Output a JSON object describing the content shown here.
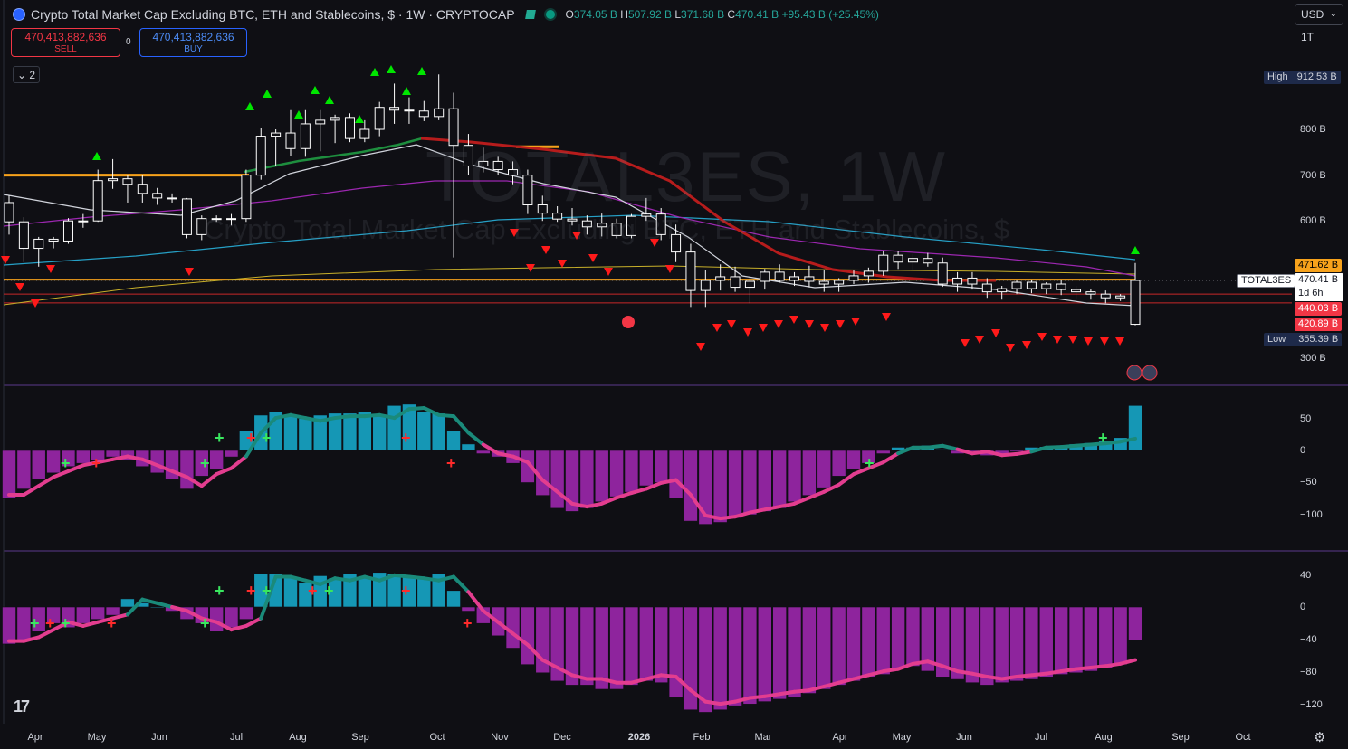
{
  "header": {
    "title": "Crypto Total Market Cap Excluding BTC, ETH and Stablecoins, $ · 1W · CRYPTOCAP",
    "ohlc": {
      "o_label": "O",
      "o": "374.05 B",
      "h_label": "H",
      "h": "507.92 B",
      "l_label": "L",
      "l": "371.68 B",
      "c_label": "C",
      "c": "470.41 B",
      "change": "+95.43 B (+25.45%)"
    }
  },
  "trade": {
    "sell_price": "470,413,882,636",
    "sell_label": "SELL",
    "spread": "0",
    "buy_price": "470,413,882,636",
    "buy_label": "BUY"
  },
  "indicators_toggle": "2",
  "currency": {
    "label": "USD",
    "icon": "chevron-down-icon"
  },
  "interval": "1T",
  "watermark": {
    "symbol": "TOTAL3ES, 1W",
    "description": "Crypto Total Market Cap Excluding BTC, ETH and Stablecoins, $"
  },
  "price_scale": {
    "ticks": [
      "800 B",
      "700 B",
      "600 B",
      "300 B"
    ]
  },
  "price_badges": {
    "high_label": "High",
    "high_value": "912.53 B",
    "low_label": "Low",
    "low_value": "355.39 B",
    "orange_value": "471.62 B",
    "symbol": "TOTAL3ES",
    "last_value": "470.41 B",
    "countdown": "1d 6h",
    "red_top": "440.03 B",
    "red_bottom": "420.89 B"
  },
  "pane2": {
    "ticks": [
      "50",
      "0",
      "−50",
      "−100"
    ]
  },
  "pane3": {
    "ticks": [
      "40",
      "0",
      "−40",
      "−80",
      "−120"
    ]
  },
  "time_axis": {
    "labels": [
      "Apr",
      "May",
      "Jun",
      "Jul",
      "Aug",
      "Sep",
      "Oct",
      "Nov",
      "Dec",
      "2026",
      "Feb",
      "Mar",
      "Apr",
      "May",
      "Jun",
      "Jul",
      "Aug",
      "Sep",
      "Oct"
    ]
  },
  "colors": {
    "background": "#0f0f14",
    "up_candle": "#ffffff",
    "down_candle": "#ffffff",
    "red_line": "#b71c1c",
    "purple_line": "#9c27b0",
    "cyan_line": "#26a0c6",
    "yellow_line": "#c8b02a",
    "white_line": "#d1d4dc",
    "green_line": "#1e8e3e",
    "hist_pos": "#1597b5",
    "hist_neg": "#8e249d",
    "wave_pos": "#1a8a7a",
    "wave_neg": "#e33d8f",
    "signal_up": "#00e600",
    "signal_down": "#ff1a1a"
  },
  "chart_data": {
    "type": "candlestick",
    "interval": "1W",
    "symbol": "TOTAL3ES",
    "ohlc_approx_B": [
      [
        640,
        655,
        570,
        598
      ],
      [
        598,
        608,
        510,
        540
      ],
      [
        540,
        565,
        500,
        560
      ],
      [
        560,
        565,
        540,
        556
      ],
      [
        556,
        606,
        550,
        600
      ],
      [
        600,
        615,
        585,
        600
      ],
      [
        600,
        712,
        598,
        688
      ],
      [
        688,
        735,
        670,
        692
      ],
      [
        692,
        700,
        640,
        680
      ],
      [
        680,
        700,
        640,
        660
      ],
      [
        660,
        672,
        635,
        650
      ],
      [
        650,
        660,
        640,
        648
      ],
      [
        648,
        650,
        562,
        570
      ],
      [
        570,
        612,
        558,
        605
      ],
      [
        605,
        612,
        598,
        604
      ],
      [
        604,
        615,
        590,
        605
      ],
      [
        605,
        712,
        598,
        700
      ],
      [
        700,
        802,
        690,
        785
      ],
      [
        785,
        800,
        720,
        792
      ],
      [
        792,
        842,
        742,
        758
      ],
      [
        758,
        842,
        740,
        812
      ],
      [
        812,
        842,
        752,
        820
      ],
      [
        820,
        832,
        770,
        826
      ],
      [
        826,
        835,
        772,
        780
      ],
      [
        780,
        820,
        772,
        800
      ],
      [
        800,
        860,
        785,
        848
      ],
      [
        848,
        900,
        812,
        842
      ],
      [
        842,
        870,
        812,
        840
      ],
      [
        840,
        862,
        818,
        828
      ],
      [
        828,
        920,
        820,
        845
      ],
      [
        845,
        880,
        520,
        765
      ],
      [
        765,
        790,
        700,
        720
      ],
      [
        720,
        760,
        706,
        730
      ],
      [
        730,
        740,
        700,
        712
      ],
      [
        712,
        730,
        680,
        700
      ],
      [
        700,
        712,
        615,
        635
      ],
      [
        635,
        655,
        600,
        617
      ],
      [
        617,
        632,
        598,
        604
      ],
      [
        604,
        628,
        590,
        600
      ],
      [
        600,
        612,
        570,
        587
      ],
      [
        587,
        616,
        566,
        595
      ],
      [
        595,
        605,
        562,
        568
      ],
      [
        568,
        615,
        562,
        610
      ],
      [
        610,
        650,
        600,
        615
      ],
      [
        615,
        628,
        558,
        570
      ],
      [
        570,
        592,
        510,
        532
      ],
      [
        532,
        550,
        412,
        448
      ],
      [
        448,
        492,
        412,
        470
      ],
      [
        470,
        505,
        448,
        478
      ],
      [
        478,
        500,
        445,
        455
      ],
      [
        455,
        478,
        420,
        468
      ],
      [
        468,
        495,
        450,
        488
      ],
      [
        488,
        505,
        465,
        470
      ],
      [
        470,
        488,
        458,
        478
      ],
      [
        478,
        502,
        455,
        468
      ],
      [
        468,
        492,
        445,
        462
      ],
      [
        462,
        475,
        445,
        470
      ],
      [
        470,
        492,
        462,
        480
      ],
      [
        480,
        498,
        465,
        490
      ],
      [
        490,
        535,
        480,
        525
      ],
      [
        525,
        535,
        495,
        510
      ],
      [
        510,
        528,
        492,
        518
      ],
      [
        518,
        530,
        500,
        508
      ],
      [
        508,
        520,
        456,
        462
      ],
      [
        462,
        488,
        445,
        475
      ],
      [
        475,
        488,
        450,
        462
      ],
      [
        462,
        475,
        432,
        445
      ],
      [
        445,
        458,
        428,
        452
      ],
      [
        452,
        470,
        440,
        466
      ],
      [
        466,
        472,
        442,
        452
      ],
      [
        452,
        466,
        440,
        462
      ],
      [
        462,
        470,
        438,
        450
      ],
      [
        450,
        458,
        430,
        445
      ],
      [
        445,
        452,
        428,
        440
      ],
      [
        440,
        448,
        420,
        432
      ],
      [
        432,
        440,
        425,
        436
      ],
      [
        374,
        508,
        372,
        470
      ]
    ],
    "moving_averages": [
      "red",
      "white",
      "green",
      "purple",
      "cyan",
      "yellow"
    ],
    "horizontal_levels_B": [
      {
        "value": 471.62,
        "color": "orange"
      },
      {
        "value": 440.03,
        "color": "red"
      },
      {
        "value": 420.89,
        "color": "red"
      }
    ],
    "price_range_B": [
      290,
      935
    ],
    "pane2": {
      "range": [
        -130,
        80
      ]
    },
    "pane3": {
      "range": [
        -135,
        50
      ]
    }
  }
}
